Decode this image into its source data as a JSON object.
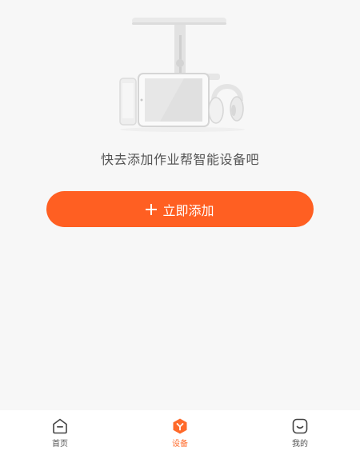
{
  "main": {
    "empty_message": "快去添加作业帮智能设备吧",
    "add_button_label": "立即添加",
    "illustration_icon": "smart-devices-illustration"
  },
  "tabbar": {
    "active_index": 1,
    "items": [
      {
        "label": "首页",
        "icon": "home-icon"
      },
      {
        "label": "设备",
        "icon": "device-icon"
      },
      {
        "label": "我的",
        "icon": "profile-icon"
      }
    ]
  },
  "colors": {
    "accent": "#ff5f22",
    "background": "#f7f7f7",
    "tabbar_background": "#ffffff",
    "text_secondary": "#555555"
  }
}
